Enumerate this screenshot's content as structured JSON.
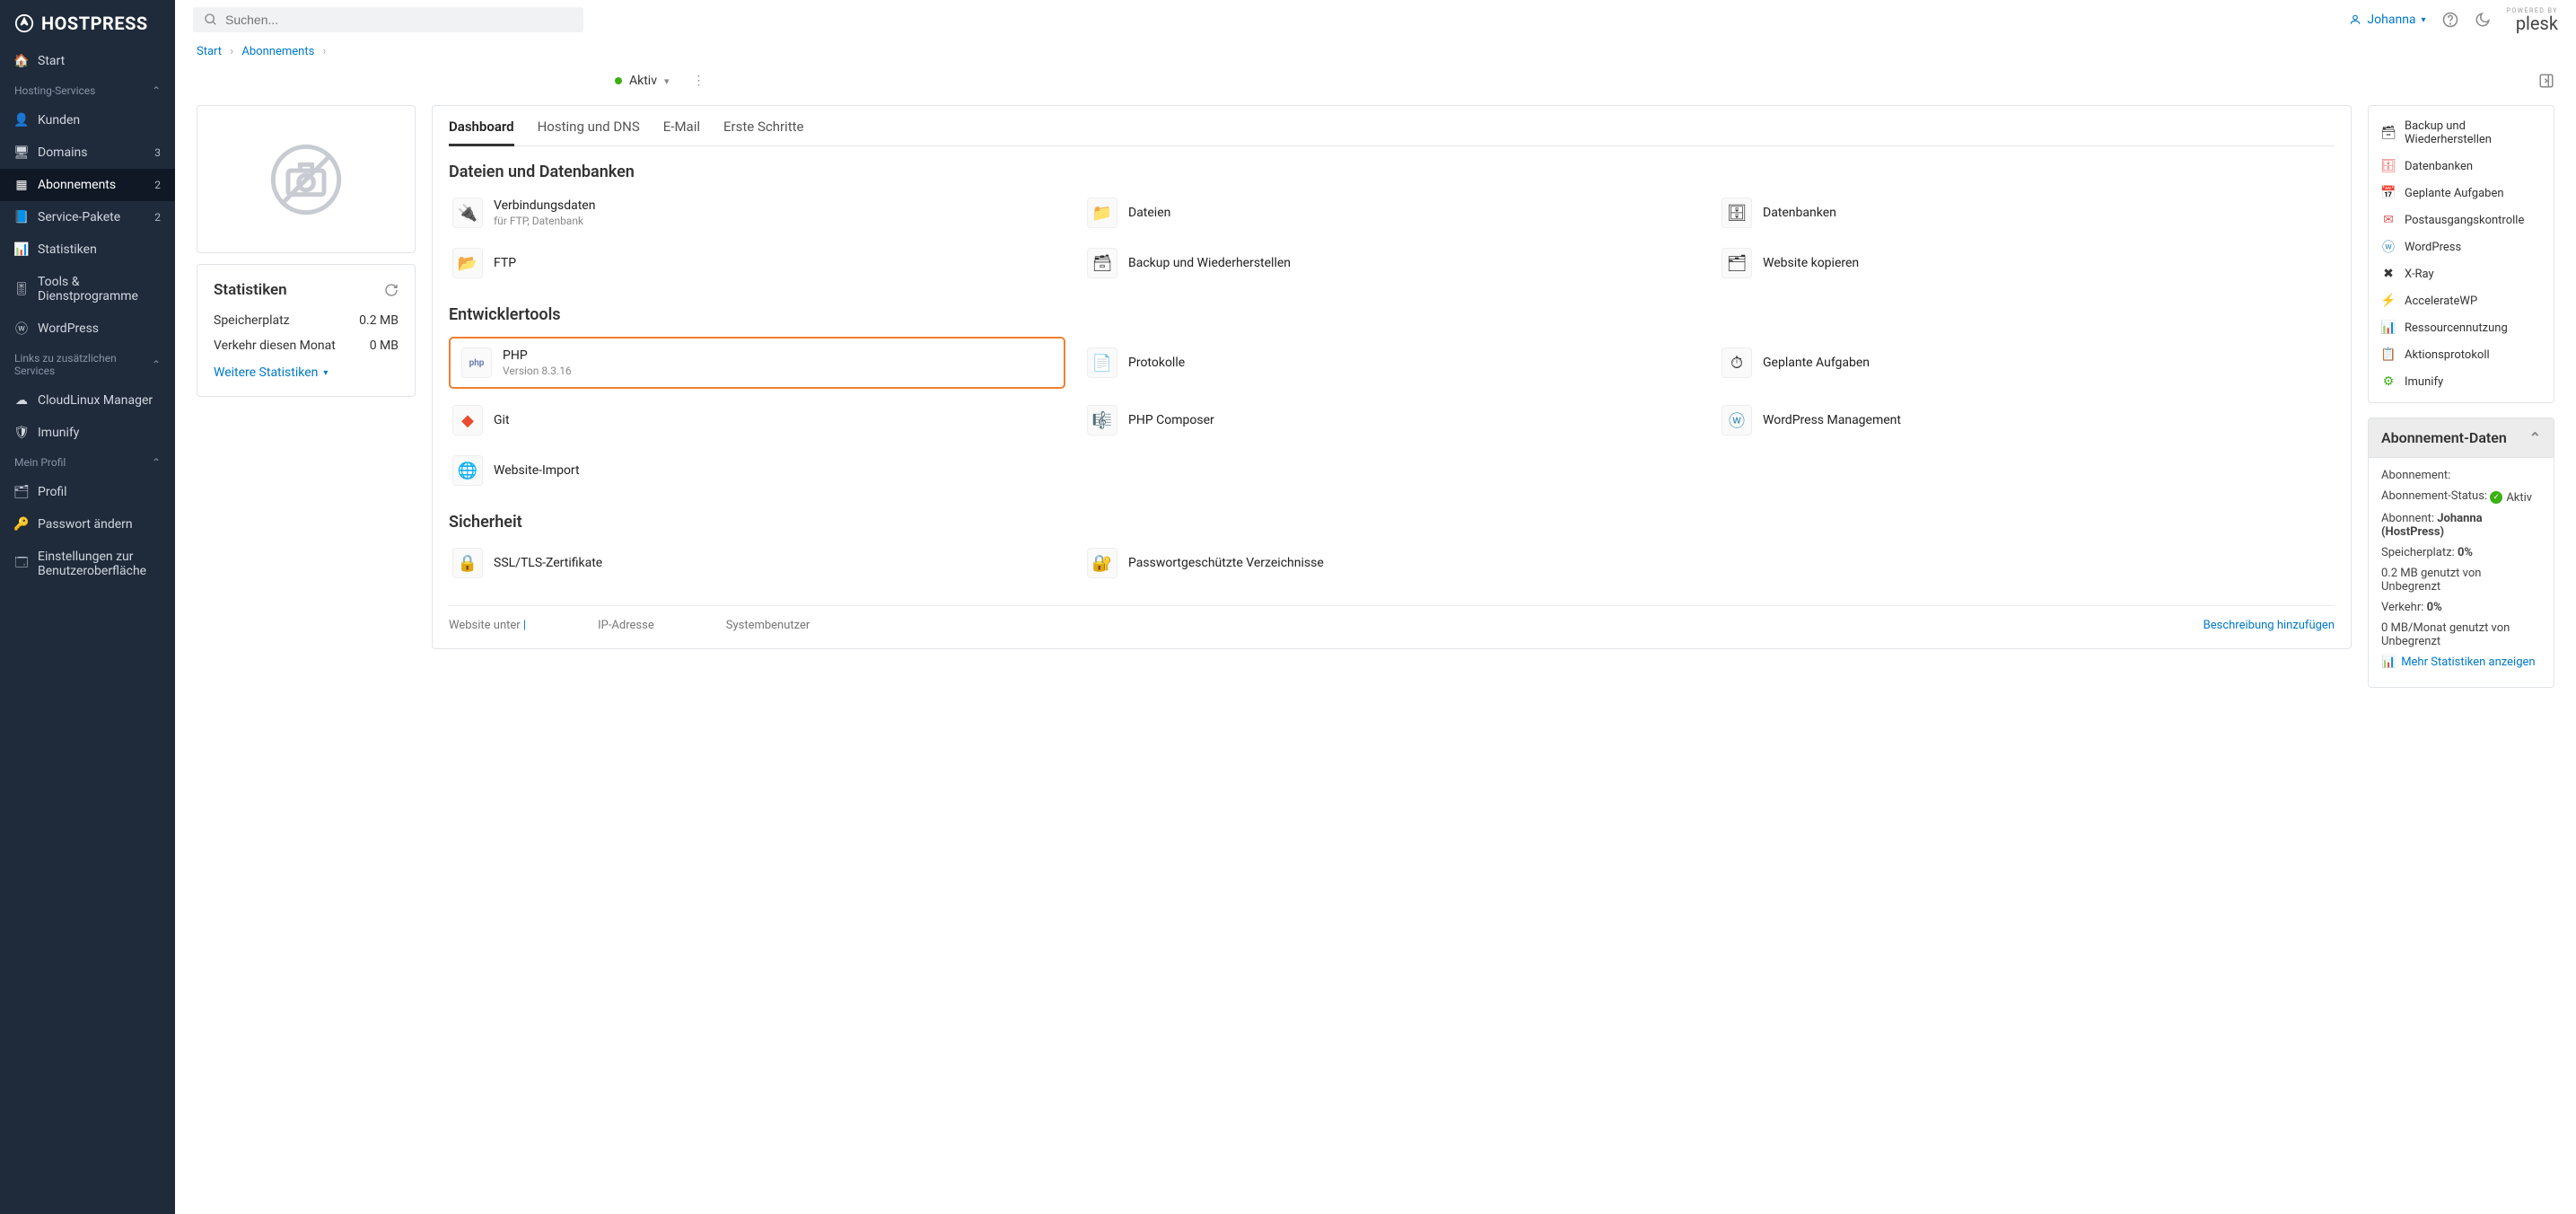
{
  "brand": "HOSTPRESS",
  "search_placeholder": "Suchen...",
  "user_name": "Johanna",
  "plesk": {
    "powered": "POWERED BY",
    "name": "plesk"
  },
  "breadcrumb": {
    "start": "Start",
    "abos": "Abonnements"
  },
  "status": {
    "label": "Aktiv"
  },
  "sidebar": {
    "start": "Start",
    "section_hosting": "Hosting-Services",
    "kunden": "Kunden",
    "domains": "Domains",
    "domains_badge": "3",
    "abonnements": "Abonnements",
    "abonnements_badge": "2",
    "service_pakete": "Service-Pakete",
    "service_pakete_badge": "2",
    "statistiken": "Statistiken",
    "tools": "Tools & Dienstprogramme",
    "wordpress": "WordPress",
    "section_links": "Links zu zusätzlichen Services",
    "cloudlinux": "CloudLinux Manager",
    "imunify": "Imunify",
    "section_profil": "Mein Profil",
    "profil": "Profil",
    "passwort": "Passwort ändern",
    "einstellungen": "Einstellungen zur Benutzeroberfläche"
  },
  "stats_card": {
    "title": "Statistiken",
    "space_label": "Speicherplatz",
    "space_val": "0.2 MB",
    "traffic_label": "Verkehr diesen Monat",
    "traffic_val": "0 MB",
    "more": "Weitere Statistiken"
  },
  "tabs": {
    "dashboard": "Dashboard",
    "hosting": "Hosting und DNS",
    "email": "E-Mail",
    "first": "Erste Schritte"
  },
  "sections": {
    "files": "Dateien und Datenbanken",
    "dev": "Entwicklertools",
    "security": "Sicherheit"
  },
  "tools": {
    "conn": {
      "t": "Verbindungsdaten",
      "s": "für FTP, Datenbank"
    },
    "files": "Dateien",
    "db": "Datenbanken",
    "ftp": "FTP",
    "backup": "Backup und Wiederherstellen",
    "copy": "Website kopieren",
    "php": {
      "t": "PHP",
      "s": "Version 8.3.16"
    },
    "logs": "Protokolle",
    "sched": "Geplante Aufgaben",
    "git": "Git",
    "composer": "PHP Composer",
    "wpm": "WordPress Management",
    "import": "Website-Import",
    "ssl": "SSL/TLS-Zertifikate",
    "pwdir": "Passwortgeschützte Verzeichnisse"
  },
  "bottom": {
    "website_under": "Website unter",
    "ip": "IP-Adresse",
    "sysuser": "Systembenutzer",
    "add_desc": "Beschreibung hinzufügen"
  },
  "quick": [
    "Backup und Wiederherstellen",
    "Datenbanken",
    "Geplante Aufgaben",
    "Postausgangskontrolle",
    "WordPress",
    "X-Ray",
    "AccelerateWP",
    "Ressourcennutzung",
    "Aktionsprotokoll",
    "Imunify"
  ],
  "panel": {
    "title": "Abonnement-Daten",
    "abo_label": "Abonnement:",
    "status_label": "Abonnement-Status:",
    "status_val": "Aktiv",
    "subscriber_label": "Abonnent:",
    "subscriber_val": "Johanna (HostPress)",
    "space_label": "Speicherplatz:",
    "space_pct": "0%",
    "space_line": "0.2 MB genutzt von Unbegrenzt",
    "traffic_label": "Verkehr:",
    "traffic_pct": "0%",
    "traffic_line": "0 MB/Monat genutzt von Unbegrenzt",
    "more": "Mehr Statistiken anzeigen"
  }
}
